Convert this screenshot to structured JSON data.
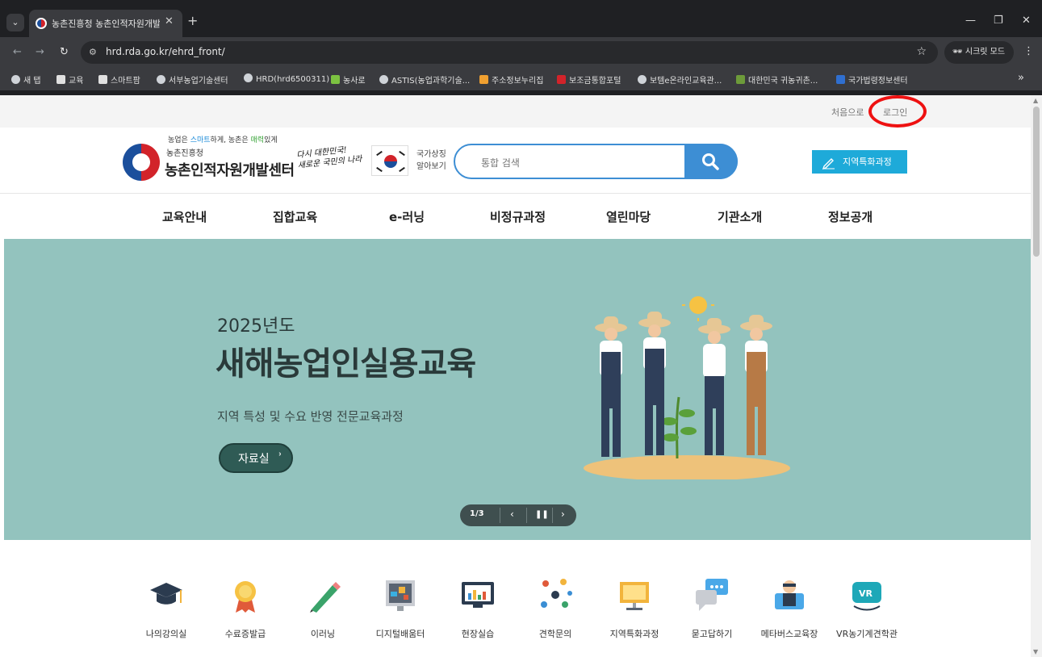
{
  "browser": {
    "tab_title": "농촌진흥청 농촌인적자원개발센터",
    "url": "hrd.rda.go.kr/ehrd_front/",
    "incognito_label": "시크릿 모드",
    "bookmarks": [
      {
        "label": "새 탭",
        "icon": "globe-icon"
      },
      {
        "label": "교육",
        "icon": "folder-icon"
      },
      {
        "label": "스마트팜",
        "icon": "folder-icon"
      },
      {
        "label": "서부농업기술센터",
        "icon": "globe-icon"
      },
      {
        "label": "HRD(hrd6500311)",
        "icon": "globe-icon"
      },
      {
        "label": "농사로",
        "icon": "nongsaro-icon"
      },
      {
        "label": "ASTIS(농업과학기술...",
        "icon": "globe-icon"
      },
      {
        "label": "주소정보누리집",
        "icon": "house-icon"
      },
      {
        "label": "보조금통합포털",
        "icon": "gov-icon"
      },
      {
        "label": "보템e온라인교육관...",
        "icon": "globe-icon"
      },
      {
        "label": "대한민국 귀농귀촌...",
        "icon": "tree-icon"
      },
      {
        "label": "국가법령정보센터",
        "icon": "law-icon"
      }
    ]
  },
  "utility": {
    "home": "처음으로",
    "login": "로그인"
  },
  "header": {
    "slogan_pre": "농업은 ",
    "slogan_smart": "스마트",
    "slogan_mid": "하게, 농촌은 ",
    "slogan_charm": "매력",
    "slogan_post": "있게",
    "org": "농촌진흥청",
    "center_name": "농촌인적자원개발센터",
    "calligraphy_line1": "다시 대한민국!",
    "calligraphy_line2": "새로운 국민의 나라",
    "symbol_line1": "국가상징",
    "symbol_line2": "알아보기",
    "search_placeholder": "통합 검색",
    "region_button": "지역특화과정"
  },
  "gnb": [
    "교육안내",
    "집합교육",
    "e-러닝",
    "비정규과정",
    "열린마당",
    "기관소개",
    "정보공개"
  ],
  "banner": {
    "year": "2025년도",
    "title": "새해농업인실용교육",
    "subtitle": "지역 특성 및 수요 반영 전문교육과정",
    "button": "자료실",
    "slide_counter": "1/3",
    "bg_color": "#93c3be"
  },
  "quick_menu": [
    {
      "label": "나의강의실",
      "icon": "graduation-cap-icon"
    },
    {
      "label": "수료증발급",
      "icon": "medal-icon"
    },
    {
      "label": "이러닝",
      "icon": "pencil-icon"
    },
    {
      "label": "디지털배움터",
      "icon": "digital-board-icon"
    },
    {
      "label": "현장실습",
      "icon": "chart-screen-icon"
    },
    {
      "label": "견학문의",
      "icon": "network-icon"
    },
    {
      "label": "지역특화과정",
      "icon": "monitor-icon"
    },
    {
      "label": "묻고답하기",
      "icon": "chat-bubbles-icon"
    },
    {
      "label": "메타버스교육장",
      "icon": "avatar-icon"
    },
    {
      "label": "VR농기계견학관",
      "icon": "vr-headset-icon"
    }
  ]
}
